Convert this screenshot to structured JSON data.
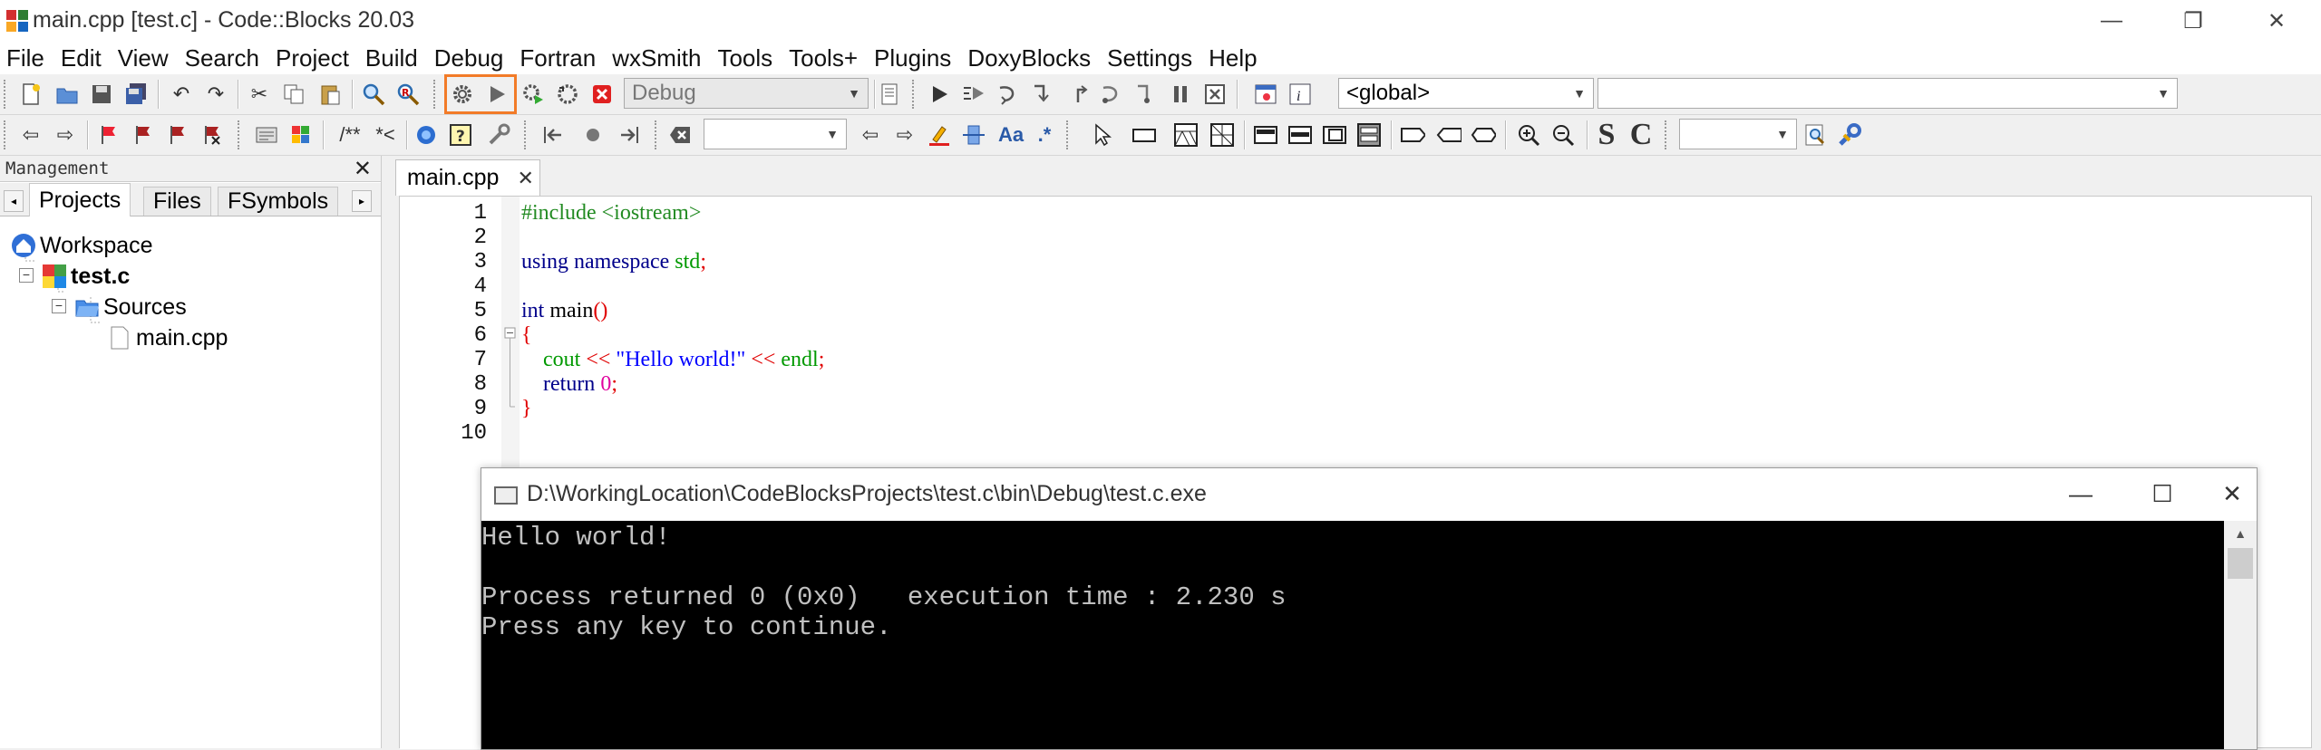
{
  "window": {
    "title": "main.cpp [test.c] - Code::Blocks 20.03",
    "controls": [
      "—",
      "❐",
      "✕"
    ]
  },
  "menu": [
    "File",
    "Edit",
    "View",
    "Search",
    "Project",
    "Build",
    "Debug",
    "Fortran",
    "wxSmith",
    "Tools",
    "Tools+",
    "Plugins",
    "DoxyBlocks",
    "Settings",
    "Help"
  ],
  "toolbar": {
    "build_target": "Debug",
    "scope": "<global>",
    "symbol": "",
    "comment_label": "/**",
    "comment_label2": "*<",
    "search_combo": "",
    "search2_combo": "",
    "s_label": "S",
    "c_label": "C",
    "aa_label": "Aa",
    "regex_label": ".*",
    "colors": {
      "highlight": "#f27b28"
    }
  },
  "management": {
    "title": "Management",
    "close": "✕",
    "tabs": [
      "Projects",
      "Files",
      "FSymbols"
    ],
    "tree": {
      "workspace": "Workspace",
      "project": "test.c",
      "folder": "Sources",
      "file": "main.cpp",
      "toggle_minus": "−"
    }
  },
  "editor": {
    "tab_label": "main.cpp",
    "tab_close": "✕",
    "line_numbers": [
      "1",
      "2",
      "3",
      "4",
      "5",
      "6",
      "7",
      "8",
      "9",
      "10"
    ],
    "code": {
      "l1": "#include <iostream>",
      "l3_kw1": "using",
      "l3_kw2": "namespace",
      "l3_id": "std",
      "l3_semi": ";",
      "l5_kw": "int",
      "l5_id": "main",
      "l5_paren": "()",
      "l6": "{",
      "l7_cout": "cout",
      "l7_op1": "<<",
      "l7_str": "\"Hello world!\"",
      "l7_op2": "<<",
      "l7_endl": "endl",
      "l7_semi": ";",
      "l8_kw": "return",
      "l8_num": "0",
      "l8_semi": ";",
      "l9": "}"
    }
  },
  "console": {
    "title": "D:\\WorkingLocation\\CodeBlocksProjects\\test.c\\bin\\Debug\\test.c.exe",
    "lines": [
      "Hello world!",
      "",
      "Process returned 0 (0x0)   execution time : 2.230 s",
      "Press any key to continue."
    ],
    "controls": [
      "—",
      "☐",
      "✕"
    ]
  }
}
